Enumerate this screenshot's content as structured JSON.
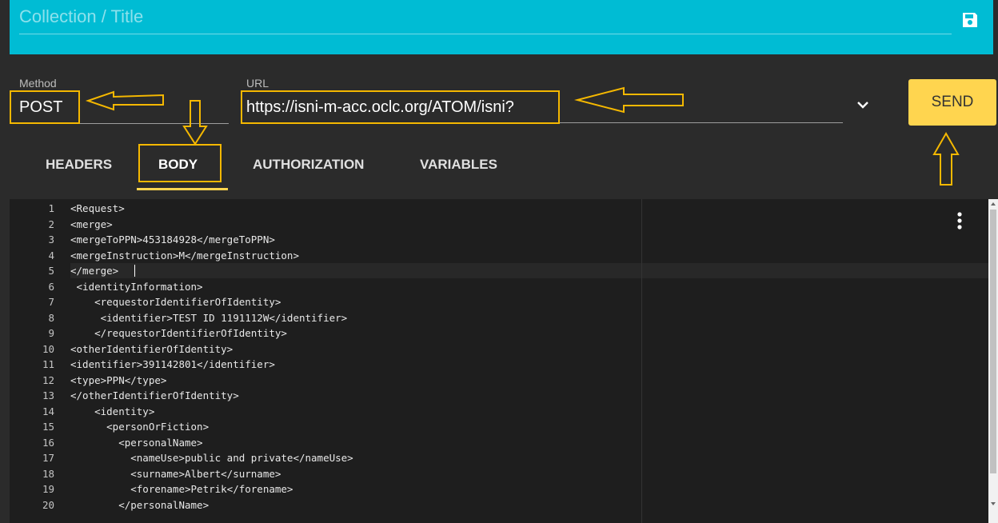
{
  "header": {
    "title": "Collection / Title",
    "save_icon": "floppy-disk-icon"
  },
  "request": {
    "method_label": "Method",
    "method_value": "POST",
    "url_label": "URL",
    "url_value": "https://isni-m-acc.oclc.org/ATOM/isni?",
    "send_label": "SEND"
  },
  "tabs": [
    {
      "label": "HEADERS",
      "active": false
    },
    {
      "label": "BODY",
      "active": true
    },
    {
      "label": "AUTHORIZATION",
      "active": false
    },
    {
      "label": "VARIABLES",
      "active": false
    }
  ],
  "editor": {
    "lines": [
      "<Request>",
      "<merge>",
      "<mergeToPPN>453184928</mergeToPPN>",
      "<mergeInstruction>M</mergeInstruction>",
      "</merge>",
      " <identityInformation>",
      "    <requestorIdentifierOfIdentity>",
      "     <identifier>TEST ID 1191112W</identifier>",
      "    </requestorIdentifierOfIdentity>",
      "<otherIdentifierOfIdentity>",
      "<identifier>391142801</identifier>",
      "<type>PPN</type>",
      "</otherIdentifierOfIdentity>",
      "    <identity>",
      "      <personOrFiction>",
      "        <personalName>",
      "          <nameUse>public and private</nameUse>",
      "          <surname>Albert</surname>",
      "          <forename>Petrik</forename>",
      "        </personalName>"
    ],
    "line_numbers": [
      "1",
      "2",
      "3",
      "4",
      "5",
      "6",
      "7",
      "8",
      "9",
      "10",
      "11",
      "12",
      "13",
      "14",
      "15",
      "16",
      "17",
      "18",
      "19",
      "20"
    ]
  },
  "colors": {
    "accent": "#00bcd4",
    "send": "#ffd54f",
    "annotation": "#f5b800",
    "editor_bg": "#1e1e1e"
  }
}
